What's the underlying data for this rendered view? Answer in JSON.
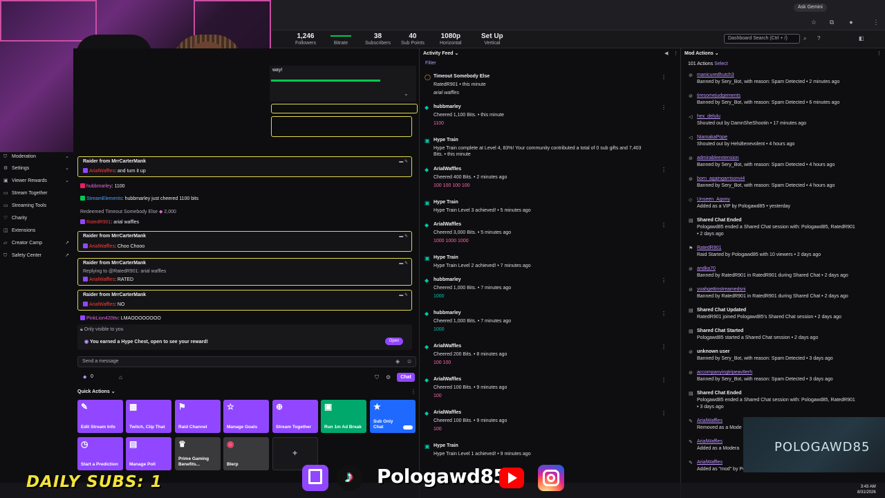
{
  "browser": {
    "ask_gemini": "Ask Gemini"
  },
  "stats": [
    {
      "num": "1,246",
      "lbl": "Followers"
    },
    {
      "num": "",
      "lbl": "Bitrate"
    },
    {
      "num": "38",
      "lbl": "Subscribers"
    },
    {
      "num": "40",
      "lbl": "Sub Points"
    },
    {
      "num": "1080p",
      "lbl": "Horizontal"
    },
    {
      "num": "Set Up",
      "lbl": "Vertical"
    }
  ],
  "search": {
    "placeholder": "Dashboard Search (Ctrl + /)"
  },
  "hype": {
    "title": "way!",
    "progress": 0.63
  },
  "sidebar": {
    "items": [
      {
        "label": "Moderation",
        "icon": "shield-icon",
        "chev": "⌄"
      },
      {
        "label": "Settings",
        "icon": "gear-icon",
        "chev": "⌄"
      },
      {
        "label": "Viewer Rewards",
        "icon": "gift-icon",
        "chev": "⌄"
      },
      {
        "label": "Stream Together",
        "icon": "users-icon",
        "chev": ""
      },
      {
        "label": "Streaming Tools",
        "icon": "tools-icon",
        "chev": ""
      },
      {
        "label": "Charity",
        "icon": "heart-icon",
        "chev": ""
      },
      {
        "label": "Extensions",
        "icon": "puzzle-icon",
        "chev": ""
      },
      {
        "label": "Creator Camp",
        "icon": "camp-icon",
        "chev": "↗"
      },
      {
        "label": "Safety Center",
        "icon": "safety-icon",
        "chev": "↗"
      }
    ]
  },
  "chat": {
    "raid1": {
      "header": "Raider from MrrCarterMank",
      "user": "ArialWaffles",
      "msg": ": and turn it up"
    },
    "line_hubb": {
      "user": "hubbmarley",
      "msg": ": 1100"
    },
    "line_se": {
      "user": "StreamElements",
      "msg": ": hubbmarley just cheered 1100 bits"
    },
    "redeem": {
      "text": "Redeemed Timeout Somebody Else",
      "cost": "2,000"
    },
    "line_rated": {
      "user": "RatedR901",
      "msg": ": arial waffles"
    },
    "raid2": {
      "header": "Raider from MrrCarterMank",
      "user": "ArialWaffles",
      "msg": ": Choo Chooo"
    },
    "raid3": {
      "header": "Raider from MrrCarterMank",
      "reply": "Replying to @RatedR901: arial waffles",
      "user": "ArialWaffles",
      "msg": ": RATED"
    },
    "raid4": {
      "header": "Raider from MrrCarterMank",
      "user": "ArialWaffles",
      "msg": ": NO"
    },
    "line_pink": {
      "user": "PinkLion420ttv",
      "msg": ": LMAOOOOOOOO"
    },
    "only_visible": "Only visible to you",
    "hype_chest": "You earned a Hype Chest, open to see your reward!",
    "open_label": "Open",
    "send_placeholder": "Send a message",
    "points": "0",
    "chat_label": "Chat"
  },
  "quick_actions": {
    "title": "Quick Actions",
    "items": [
      {
        "label": "Edit Stream Info",
        "icon": "pencil-icon",
        "glyph": "✎",
        "color": "#9147ff"
      },
      {
        "label": "Twitch, Clip That",
        "icon": "clip-icon",
        "glyph": "▦",
        "color": "#9147ff"
      },
      {
        "label": "Raid Channel",
        "icon": "raid-icon",
        "glyph": "⚑",
        "color": "#9147ff"
      },
      {
        "label": "Manage Goals",
        "icon": "star-icon",
        "glyph": "☆",
        "color": "#9147ff"
      },
      {
        "label": "Stream Together",
        "icon": "add-user-icon",
        "glyph": "⊕",
        "color": "#9147ff"
      },
      {
        "label": "Run 1m Ad Break",
        "icon": "ad-icon",
        "glyph": "▣",
        "color": "#00a86b"
      },
      {
        "label": "Sub Only Chat",
        "icon": "star-filled-icon",
        "glyph": "★",
        "color": "#1f69ff"
      },
      {
        "label": "Start a Prediction",
        "icon": "prediction-icon",
        "glyph": "◷",
        "color": "#9147ff"
      },
      {
        "label": "Manage Poll",
        "icon": "poll-icon",
        "glyph": "▤",
        "color": "#9147ff"
      },
      {
        "label": "Prime Gaming Benefits...",
        "icon": "crown-icon",
        "glyph": "♛",
        "color": "#3a3a3d"
      },
      {
        "label": "Blerp",
        "icon": "blerp-icon",
        "glyph": "◉",
        "color": "#3a3a3d"
      }
    ]
  },
  "activity": {
    "title": "Activity Feed",
    "filter": "Filter",
    "items": [
      {
        "name": "Timeout Somebody Else",
        "desc": "RatedR901 • this minute",
        "extra": "arial waffles"
      },
      {
        "name": "hubbmarley",
        "desc": "Cheered 1,100 Bits. • this minute",
        "extra": "1100"
      },
      {
        "name": "Hype Train",
        "desc": "Hype Train complete at Level 4, 83%! Your community contributed a total of 0 sub gifts and 7,403",
        "extra": "Bits. • this minute"
      },
      {
        "name": "ArialWaffles",
        "desc": "Cheered 400 Bits. • 2 minutes ago",
        "extra": "100 100 100 100"
      },
      {
        "name": "Hype Train",
        "desc": "Hype Train Level 3 achieved! • 5 minutes ago",
        "extra": ""
      },
      {
        "name": "ArialWaffles",
        "desc": "Cheered 3,000 Bits. • 5 minutes ago",
        "extra": "1000 1000 1000"
      },
      {
        "name": "Hype Train",
        "desc": "Hype Train Level 2 achieved! • 7 minutes ago",
        "extra": ""
      },
      {
        "name": "hubbmarley",
        "desc": "Cheered 1,000 Bits. • 7 minutes ago",
        "extra": "1000"
      },
      {
        "name": "hubbmarley",
        "desc": "Cheered 1,000 Bits. • 7 minutes ago",
        "extra": "1000"
      },
      {
        "name": "ArialWaffles",
        "desc": "Cheered 200 Bits. • 8 minutes ago",
        "extra": "100 100"
      },
      {
        "name": "ArialWaffles",
        "desc": "Cheered 100 Bits. • 9 minutes ago",
        "extra": "100"
      },
      {
        "name": "ArialWaffles",
        "desc": "Cheered 100 Bits. • 9 minutes ago",
        "extra": "100"
      },
      {
        "name": "Hype Train",
        "desc": "Hype Train Level 1 achieved! • 9 minutes ago",
        "extra": ""
      }
    ]
  },
  "mod": {
    "title": "Mod Actions",
    "count": "101 Actions",
    "select": "Select",
    "items": [
      {
        "name": "manicuredhutch3",
        "desc": "Banned by Sery_Bot, with reason: Spam Detected • 2 minutes ago",
        "desc2": ""
      },
      {
        "name": "tiresomejudgements",
        "desc": "Banned by Sery_Bot, with reason: Spam Detected • 6 minutes ago",
        "desc2": ""
      },
      {
        "name": "hex_delulu",
        "desc": "Shouted out by DamnSheShootin • 17 minutes ago",
        "desc2": ""
      },
      {
        "name": "NiamakaPope",
        "desc": "Shouted out by HelsBenevolent • 4 hours ago",
        "desc2": ""
      },
      {
        "name": "admirableextension",
        "desc": "Banned by Sery_Bot, with reason: Spam Detected • 4 hours ago",
        "desc2": ""
      },
      {
        "name": "born_againgarrisonvi4",
        "desc": "Banned by Sery_Bot, with reason: Spam Detected • 4 hours ago",
        "desc2": ""
      },
      {
        "name": "Unseen_Agony",
        "desc": "Added as a VIP by Pologawd85 • yesterday",
        "desc2": ""
      },
      {
        "name": "Shared Chat Ended",
        "desc": "Pologawd85 ended a Shared Chat session with: Pologawd85, RatedR901",
        "desc2": "• 2 days ago"
      },
      {
        "name": "RatedR901",
        "desc": "Raid Started by Pologawd85 with 10 viewers • 2 days ago",
        "desc2": ""
      },
      {
        "name": "andka70",
        "desc": "Banned by RatedR901 in RatedR901 during Shared Chat • 2 days ago",
        "desc2": ""
      },
      {
        "name": "yoahgettinstreamedsni",
        "desc": "Banned by RatedR901 in RatedR901 during Shared Chat • 2 days ago",
        "desc2": ""
      },
      {
        "name": "Shared Chat Updated",
        "desc": "RatedR901 joined Pologawd85's Shared Chat session • 2 days ago",
        "desc2": ""
      },
      {
        "name": "Shared Chat Started",
        "desc": "Pologawd85 started a Shared Chat session • 2 days ago",
        "desc2": ""
      },
      {
        "name": "unknown user",
        "desc": "Banned by Sery_Bot, with reason: Spam Detected • 3 days ago",
        "desc2": ""
      },
      {
        "name": "accompanyingtripeav8erh",
        "desc": "Banned by Sery_Bot, with reason: Spam Detected • 3 days ago",
        "desc2": ""
      },
      {
        "name": "Shared Chat Ended",
        "desc": "Pologawd85 ended a Shared Chat session with: Pologawd85, RatedR901",
        "desc2": "• 3 days ago"
      },
      {
        "name": "ArialWaffles",
        "desc": "Removed as a Mode",
        "desc2": ""
      },
      {
        "name": "ArialWaffles",
        "desc": "Added as a Modera",
        "desc2": ""
      },
      {
        "name": "ArialWaffles",
        "desc": "Added as \"mod\" by Pologawd85 • 3 days ago",
        "desc2": ""
      }
    ]
  },
  "overlay": {
    "daily_subs": "DAILY SUBS: 1",
    "brand": "Pologawd85",
    "watermark": "POLOGAWD85"
  },
  "clock": {
    "time": "3:43 AM",
    "date": "8/31/2026"
  }
}
